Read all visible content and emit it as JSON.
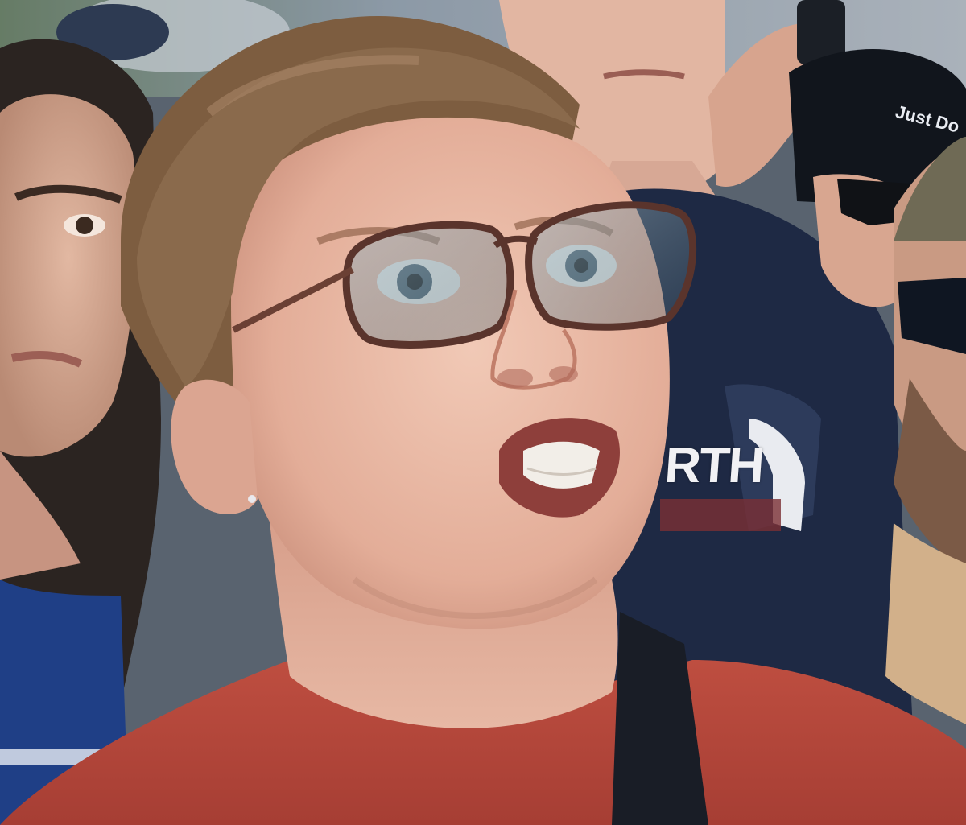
{
  "photo": {
    "shirt_text": "RTH",
    "cap_text": "Just Do"
  },
  "colors": {
    "sky": "#8fa4b8",
    "skin": "#e9b9a6",
    "hair": "#7a5a3d",
    "red_shirt": "#b5473b",
    "navy_shirt": "#1f2a44"
  }
}
